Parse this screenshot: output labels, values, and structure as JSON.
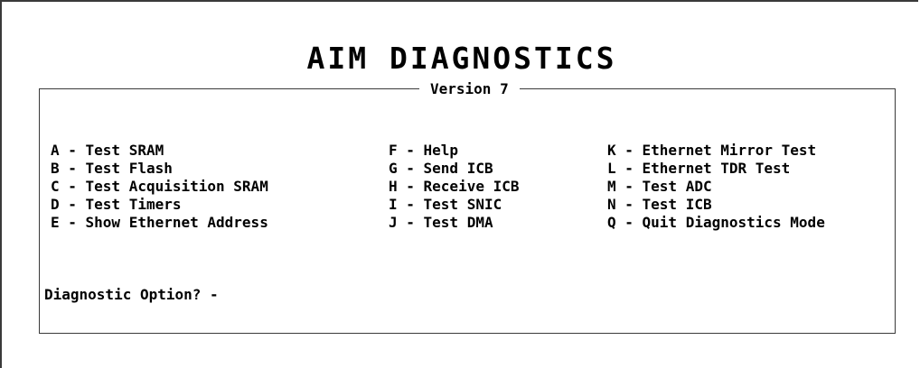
{
  "title": "AIM DIAGNOSTICS",
  "version": "Version 7",
  "menu": {
    "columns": [
      {
        "items": [
          {
            "key": "A",
            "label": "A - Test SRAM"
          },
          {
            "key": "B",
            "label": "B - Test Flash"
          },
          {
            "key": "C",
            "label": "C - Test Acquisition SRAM"
          },
          {
            "key": "D",
            "label": "D - Test Timers"
          },
          {
            "key": "E",
            "label": "E - Show Ethernet Address"
          }
        ]
      },
      {
        "items": [
          {
            "key": "F",
            "label": "F - Help"
          },
          {
            "key": "G",
            "label": "G - Send ICB"
          },
          {
            "key": "H",
            "label": "H - Receive ICB"
          },
          {
            "key": "I",
            "label": "I - Test SNIC"
          },
          {
            "key": "J",
            "label": "J - Test DMA"
          }
        ]
      },
      {
        "items": [
          {
            "key": "K",
            "label": "K - Ethernet Mirror Test"
          },
          {
            "key": "L",
            "label": "L - Ethernet TDR Test"
          },
          {
            "key": "M",
            "label": "M - Test ADC"
          },
          {
            "key": "N",
            "label": "N - Test ICB"
          },
          {
            "key": "Q",
            "label": "Q - Quit Diagnostics Mode"
          }
        ]
      }
    ]
  },
  "prompt": "Diagnostic Option? -"
}
